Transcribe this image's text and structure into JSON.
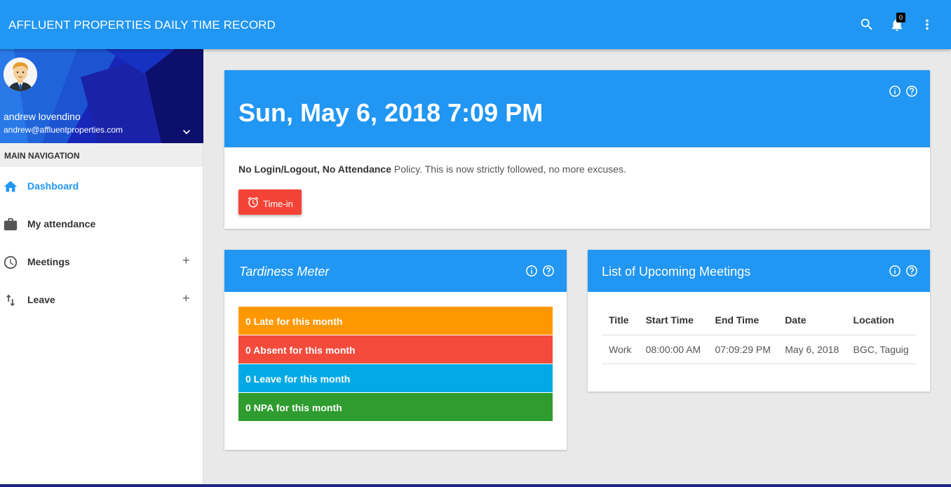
{
  "app": {
    "title": "AFFLUENT PROPERTIES DAILY TIME RECORD",
    "notification_count": "0"
  },
  "icons": {
    "search": "search-icon",
    "bell": "bell-icon",
    "more": "more-vert-icon"
  },
  "colors": {
    "primary": "#2196f3",
    "late": "#ff9800",
    "absent": "#f44336",
    "leave": "#03a9e4",
    "npa": "#2e9c2e",
    "timein": "#f44336"
  },
  "user": {
    "name": "andrew lovendino",
    "email": "andrew@affluentproperties.com"
  },
  "sidebar": {
    "header": "MAIN NAVIGATION",
    "items": [
      {
        "label": "Dashboard",
        "icon": "home-icon",
        "active": true,
        "expandable": false
      },
      {
        "label": "My attendance",
        "icon": "briefcase-icon",
        "active": false,
        "expandable": false
      },
      {
        "label": "Meetings",
        "icon": "clock-icon",
        "active": false,
        "expandable": true
      },
      {
        "label": "Leave",
        "icon": "swap-vert-icon",
        "active": false,
        "expandable": true
      }
    ],
    "expand_symbol": "+"
  },
  "datetime_card": {
    "datetime": "Sun, May 6, 2018 7:09 PM",
    "policy_bold": "No Login/Logout, No Attendance",
    "policy_text": " Policy. This is now strictly followed, no more excuses.",
    "timein_label": "Time-in"
  },
  "tardiness": {
    "title": "Tardiness Meter",
    "rows": [
      {
        "label": "0 Late for this month"
      },
      {
        "label": "0 Absent for this month"
      },
      {
        "label": "0 Leave for this month"
      },
      {
        "label": "0 NPA for this month"
      }
    ]
  },
  "meetings": {
    "title": "List of Upcoming Meetings",
    "columns": [
      "Title",
      "Start Time",
      "End Time",
      "Date",
      "Location"
    ],
    "rows": [
      [
        "Work",
        "08:00:00 AM",
        "07:09:29 PM",
        "May 6, 2018",
        "BGC, Taguig"
      ]
    ]
  }
}
